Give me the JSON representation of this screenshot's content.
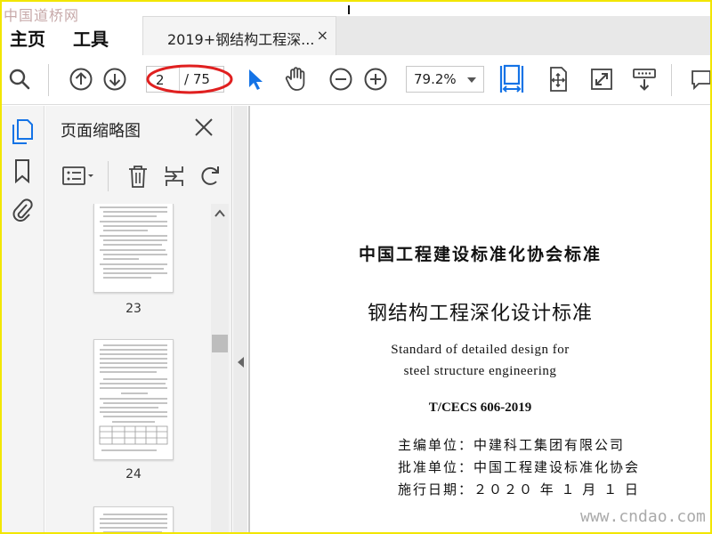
{
  "app": {
    "watermark_top": "中国道桥网",
    "watermark_bottom": "www.cndao.com"
  },
  "menu": {
    "home": "主页",
    "tools": "工具"
  },
  "tab": {
    "title": "2019+钢结构工程深...",
    "close": "×"
  },
  "toolbar": {
    "current_page": "2",
    "total_pages": "/ 75",
    "zoom": "79.2%",
    "icons": [
      "search-icon",
      "page-up-icon",
      "page-down-icon",
      "select-cursor-icon",
      "hand-tool-icon",
      "zoom-out-icon",
      "zoom-in-icon",
      "fit-width-icon",
      "fit-page-icon",
      "fullscreen-icon",
      "read-mode-icon",
      "comment-icon"
    ],
    "accent_color": "#1473e6",
    "annotation_color": "#e02020"
  },
  "rail": {
    "icons": [
      "page-thumbnails-icon",
      "bookmark-icon",
      "attachment-icon"
    ]
  },
  "panel": {
    "title": "页面缩略图",
    "thumbnails": [
      {
        "page": "23"
      },
      {
        "page": "24"
      },
      {
        "page": ""
      }
    ]
  },
  "document": {
    "org_header": "中国工程建设标准化协会标准",
    "title_cn": "钢结构工程深化设计标准",
    "title_en_line1": "Standard of detailed design for",
    "title_en_line2": "steel structure engineering",
    "code": "T/CECS 606-2019",
    "lines": [
      "主编单位：中建科工集团有限公司",
      "批准单位：中国工程建设标准化协会",
      "施行日期：２０２０ 年 １ 月 １ 日"
    ]
  }
}
